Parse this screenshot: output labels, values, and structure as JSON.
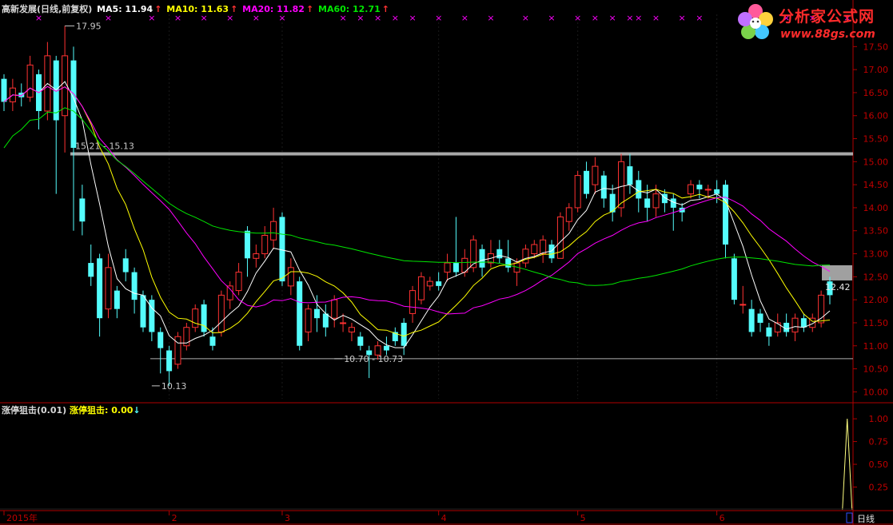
{
  "header": {
    "stock": "高新发展(日线,前复权)",
    "ma5": "MA5: 11.94",
    "ma10": "MA10: 11.63",
    "ma20": "MA20: 11.82",
    "ma60": "MA60: 12.71",
    "arrow": "↑"
  },
  "indicator": {
    "title": "涨停狙击(0.01)",
    "value": "涨停狙击: 0.00",
    "arrow": "↓"
  },
  "logo": {
    "name": "分析家公式网",
    "url": "www.88gs.com"
  },
  "period_label": "日线",
  "colors": {
    "bull": "#ff3232",
    "bear": "#54fcfc",
    "ma5": "#ffffff",
    "ma10": "#ffff00",
    "ma20": "#ff00ff",
    "ma60": "#00e600",
    "axis": "#b00000",
    "grid_label": "#c00000"
  },
  "chart_data": {
    "type": "candlestick",
    "price_axis": {
      "ticks": [
        "17.50",
        "17.00",
        "16.50",
        "16.00",
        "15.50",
        "15.00",
        "14.50",
        "14.00",
        "13.50",
        "13.00",
        "12.50",
        "12.00",
        "11.50",
        "11.00",
        "10.50",
        "10.00"
      ],
      "ylim": [
        9.85,
        18.2
      ]
    },
    "indicator_axis": {
      "ticks": [
        "1.00",
        "0.75",
        "0.50",
        "0.25"
      ],
      "ylim": [
        0,
        1.15
      ]
    },
    "x_labels": [
      {
        "label": "2015年",
        "index": 0
      },
      {
        "label": "2",
        "index": 19
      },
      {
        "label": "3",
        "index": 32
      },
      {
        "label": "4",
        "index": 50
      },
      {
        "label": "5",
        "index": 66
      },
      {
        "label": "6",
        "index": 82
      }
    ],
    "annotations": [
      {
        "text": "17.95",
        "value": 17.95,
        "index": 7
      },
      {
        "text": "10.13",
        "value": 10.13,
        "index": 17
      },
      {
        "text": "10.70 - 10.73",
        "value": 10.72,
        "index": 38
      },
      {
        "text": "15.21 - 15.13",
        "value": 15.17,
        "index": 8
      },
      {
        "text": "12.42",
        "value": 12.42,
        "index": 94
      }
    ],
    "levels": [
      15.17,
      10.72
    ],
    "zone": [
      12.42,
      12.75
    ],
    "candles": [
      [
        16.8,
        16.3,
        16.9,
        16.1
      ],
      [
        16.3,
        16.6,
        16.8,
        16.1
      ],
      [
        16.5,
        16.4,
        16.7,
        16.2
      ],
      [
        16.4,
        17.1,
        17.3,
        16.3
      ],
      [
        16.9,
        16.1,
        17.0,
        15.7
      ],
      [
        16.1,
        17.3,
        17.6,
        15.9
      ],
      [
        17.2,
        15.9,
        17.3,
        14.3
      ],
      [
        16.0,
        17.3,
        17.95,
        15.2
      ],
      [
        17.2,
        15.3,
        17.5,
        13.5
      ],
      [
        14.2,
        13.7,
        14.5,
        13.4
      ],
      [
        12.8,
        12.5,
        13.2,
        12.3
      ],
      [
        12.9,
        11.6,
        13.0,
        11.2
      ],
      [
        11.8,
        12.7,
        13.0,
        11.6
      ],
      [
        12.2,
        11.8,
        12.3,
        11.6
      ],
      [
        12.9,
        12.6,
        13.1,
        12.4
      ],
      [
        12.6,
        12.0,
        12.7,
        11.7
      ],
      [
        12.1,
        11.4,
        12.2,
        11.3
      ],
      [
        12.0,
        11.3,
        12.1,
        11.1
      ],
      [
        11.3,
        10.95,
        11.4,
        10.4
      ],
      [
        10.9,
        10.45,
        11.0,
        10.13
      ],
      [
        10.6,
        11.2,
        11.3,
        10.5
      ],
      [
        11.0,
        11.4,
        11.5,
        10.9
      ],
      [
        11.4,
        11.8,
        11.9,
        11.3
      ],
      [
        11.9,
        11.3,
        12.0,
        11.2
      ],
      [
        11.2,
        11.0,
        11.4,
        10.9
      ],
      [
        11.3,
        12.1,
        12.2,
        11.2
      ],
      [
        12.0,
        12.3,
        12.4,
        11.8
      ],
      [
        12.2,
        12.6,
        12.8,
        12.1
      ],
      [
        13.5,
        12.9,
        13.6,
        12.5
      ],
      [
        12.9,
        13.0,
        13.2,
        12.7
      ],
      [
        13.0,
        13.4,
        13.6,
        12.9
      ],
      [
        13.3,
        13.7,
        14.0,
        13.1
      ],
      [
        13.8,
        12.4,
        13.9,
        12.3
      ],
      [
        12.3,
        12.7,
        12.9,
        12.1
      ],
      [
        12.4,
        11.0,
        12.5,
        10.9
      ],
      [
        11.3,
        11.8,
        11.9,
        11.1
      ],
      [
        11.8,
        11.6,
        12.1,
        11.3
      ],
      [
        11.7,
        11.4,
        11.9,
        11.2
      ],
      [
        11.6,
        12.0,
        12.1,
        11.4
      ],
      [
        11.5,
        11.5,
        11.7,
        11.3
      ],
      [
        11.3,
        11.4,
        11.5,
        11.1
      ],
      [
        11.2,
        11.0,
        11.3,
        10.9
      ],
      [
        10.9,
        10.8,
        11.0,
        10.3
      ],
      [
        10.8,
        11.0,
        11.1,
        10.7
      ],
      [
        11.0,
        10.9,
        11.2,
        10.8
      ],
      [
        11.3,
        11.1,
        11.4,
        11.0
      ],
      [
        11.5,
        11.0,
        11.6,
        10.8
      ],
      [
        11.7,
        12.2,
        12.3,
        11.5
      ],
      [
        12.0,
        12.5,
        12.6,
        11.9
      ],
      [
        12.3,
        12.4,
        12.5,
        12.2
      ],
      [
        12.4,
        12.3,
        12.6,
        12.2
      ],
      [
        12.6,
        12.8,
        13.0,
        12.4
      ],
      [
        12.8,
        12.6,
        13.8,
        12.5
      ],
      [
        12.6,
        12.9,
        13.1,
        12.5
      ],
      [
        12.7,
        13.3,
        13.4,
        12.6
      ],
      [
        13.1,
        12.7,
        13.2,
        12.5
      ],
      [
        12.8,
        13.0,
        13.3,
        12.7
      ],
      [
        13.1,
        12.9,
        13.3,
        12.8
      ],
      [
        12.9,
        12.7,
        13.3,
        12.6
      ],
      [
        12.6,
        12.8,
        12.9,
        12.3
      ],
      [
        12.8,
        13.1,
        13.2,
        12.7
      ],
      [
        13.0,
        13.2,
        13.3,
        12.9
      ],
      [
        13.0,
        13.3,
        13.4,
        12.8
      ],
      [
        13.2,
        12.9,
        13.3,
        12.8
      ],
      [
        12.9,
        13.8,
        13.9,
        12.9
      ],
      [
        13.7,
        14.0,
        14.1,
        13.5
      ],
      [
        14.0,
        14.7,
        14.8,
        13.9
      ],
      [
        14.8,
        14.3,
        15.0,
        14.2
      ],
      [
        14.5,
        14.9,
        15.1,
        14.3
      ],
      [
        14.7,
        14.2,
        14.8,
        14.0
      ],
      [
        14.3,
        13.9,
        14.5,
        13.7
      ],
      [
        14.0,
        15.0,
        15.17,
        13.8
      ],
      [
        14.9,
        14.5,
        15.17,
        14.3
      ],
      [
        14.6,
        14.2,
        14.8,
        13.9
      ],
      [
        14.2,
        14.0,
        14.5,
        13.7
      ],
      [
        14.0,
        14.3,
        14.5,
        13.8
      ],
      [
        14.3,
        14.1,
        14.4,
        13.9
      ],
      [
        14.2,
        14.0,
        14.3,
        13.5
      ],
      [
        14.0,
        13.9,
        14.1,
        13.7
      ],
      [
        14.3,
        14.5,
        14.6,
        14.2
      ],
      [
        14.5,
        14.4,
        14.6,
        14.2
      ],
      [
        14.4,
        14.4,
        14.5,
        14.2
      ],
      [
        14.4,
        14.3,
        14.6,
        14.1
      ],
      [
        14.5,
        13.2,
        14.6,
        12.9
      ],
      [
        12.9,
        12.0,
        13.0,
        11.9
      ],
      [
        11.9,
        11.9,
        12.3,
        11.7
      ],
      [
        11.8,
        11.3,
        12.0,
        11.2
      ],
      [
        11.7,
        11.5,
        11.8,
        11.3
      ],
      [
        11.4,
        11.2,
        11.5,
        11.0
      ],
      [
        11.3,
        11.5,
        11.7,
        11.2
      ],
      [
        11.5,
        11.3,
        11.7,
        11.2
      ],
      [
        11.3,
        11.6,
        11.7,
        11.1
      ],
      [
        11.6,
        11.4,
        11.7,
        11.3
      ],
      [
        11.4,
        11.6,
        11.7,
        11.3
      ],
      [
        11.5,
        12.1,
        12.2,
        11.4
      ],
      [
        12.4,
        12.1,
        12.5,
        11.9
      ]
    ],
    "indicator_spike": {
      "index": 97,
      "value": 1.0
    }
  }
}
